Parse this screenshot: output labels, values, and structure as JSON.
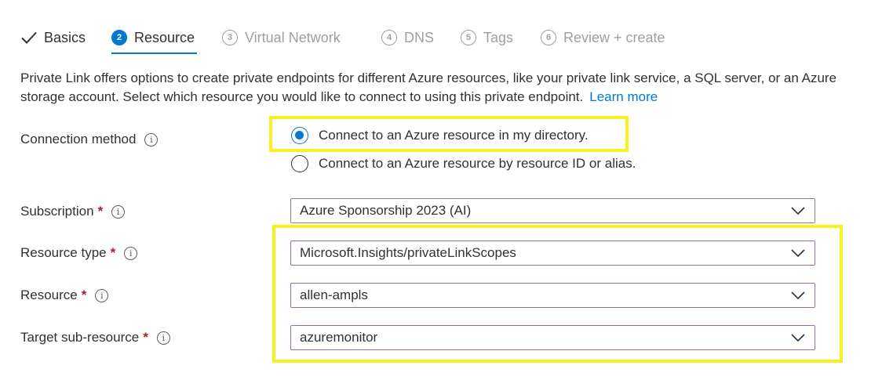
{
  "tabs": [
    {
      "num": "",
      "label": "Basics",
      "state": "done"
    },
    {
      "num": "2",
      "label": "Resource",
      "state": "active"
    },
    {
      "num": "3",
      "label": "Virtual Network",
      "state": "pending"
    },
    {
      "num": "4",
      "label": "DNS",
      "state": "pending"
    },
    {
      "num": "5",
      "label": "Tags",
      "state": "pending"
    },
    {
      "num": "6",
      "label": "Review + create",
      "state": "pending"
    }
  ],
  "description": {
    "text": "Private Link offers options to create private endpoints for different Azure resources, like your private link service, a SQL server, or an Azure storage account. Select which resource you would like to connect to using this private endpoint.",
    "link": "Learn more"
  },
  "connection_method": {
    "label": "Connection method",
    "options": [
      {
        "label": "Connect to an Azure resource in my directory.",
        "selected": true
      },
      {
        "label": "Connect to an Azure resource by resource ID or alias.",
        "selected": false
      }
    ]
  },
  "fields": {
    "subscription": {
      "label": "Subscription",
      "required_mark": "*",
      "value": "Azure Sponsorship 2023 (AI)"
    },
    "resource_type": {
      "label": "Resource type",
      "required_mark": "*",
      "value": "Microsoft.Insights/privateLinkScopes"
    },
    "resource": {
      "label": "Resource",
      "required_mark": "*",
      "value": "allen-ampls"
    },
    "target_sub_resource": {
      "label": "Target sub-resource",
      "required_mark": "*",
      "value": "azuremonitor"
    }
  },
  "info_glyph": "i",
  "colors": {
    "accent": "#0078d4",
    "highlight": "#f7f21d",
    "required": "#a4262c",
    "focus_border": "#8f6cb4"
  }
}
